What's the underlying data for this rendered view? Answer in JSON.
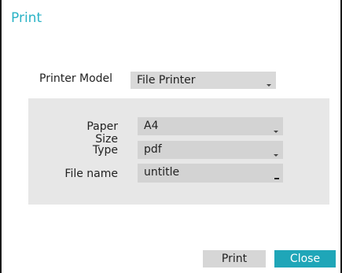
{
  "dialog": {
    "title": "Print"
  },
  "printer": {
    "label": "Printer Model",
    "value": "File Printer"
  },
  "paper_size": {
    "label": "Paper Size",
    "value": "A4"
  },
  "type": {
    "label": "Type",
    "value": "pdf"
  },
  "file_name": {
    "label": "File name",
    "value": "untitle"
  },
  "buttons": {
    "print": "Print",
    "close": "Close"
  },
  "colors": {
    "accent": "#2ab3c6",
    "close_button": "#1fa6b8",
    "panel": "#e7e7e7",
    "field": "#d3d3d3"
  }
}
